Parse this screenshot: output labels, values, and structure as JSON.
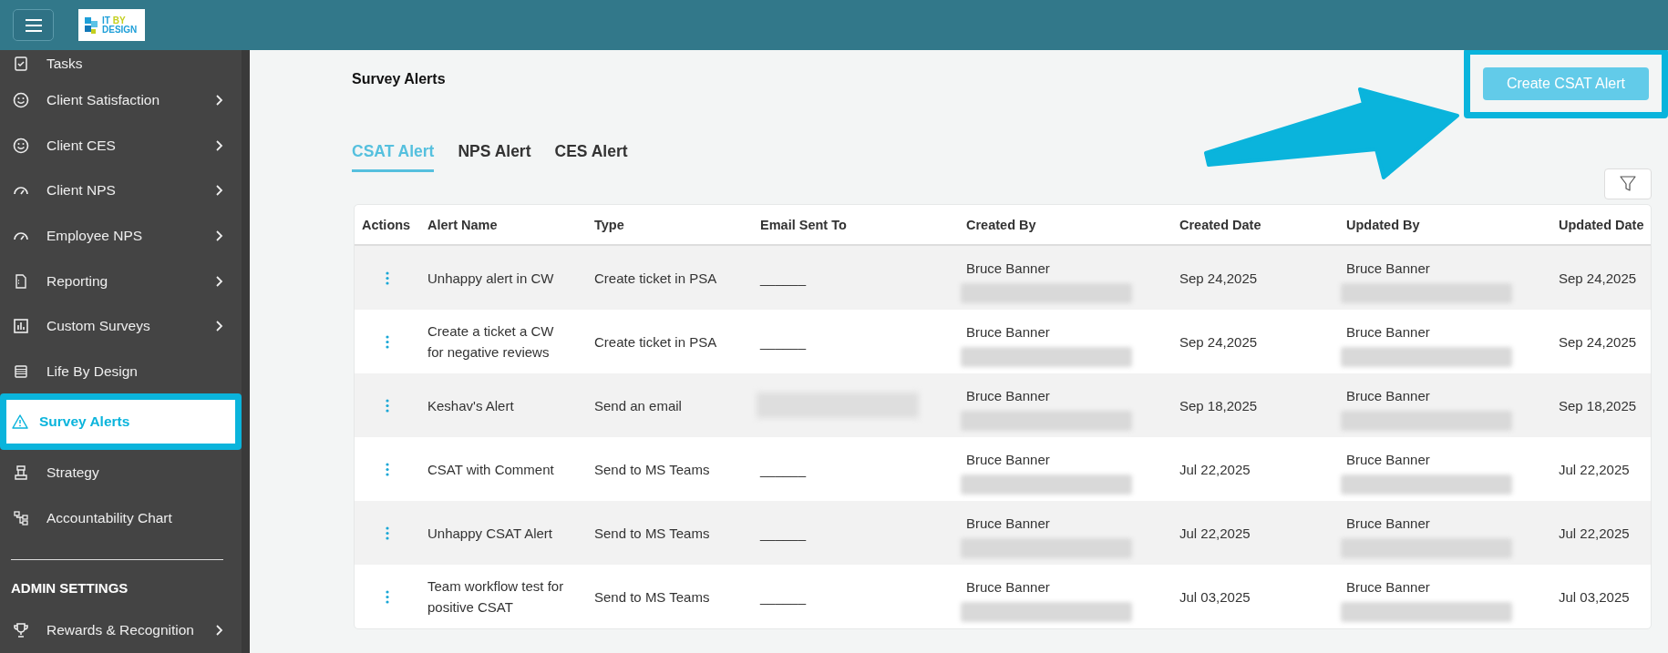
{
  "header": {
    "logo": {
      "word_1": "IT",
      "word_2": "BY",
      "word_3": "DESIGN"
    }
  },
  "sidebar": {
    "items": [
      {
        "label": "Tasks",
        "kind": "tasks",
        "has_submenu": false,
        "selected": false
      },
      {
        "label": "Client Satisfaction",
        "kind": "smiley",
        "has_submenu": true,
        "selected": false
      },
      {
        "label": "Client CES",
        "kind": "smiley",
        "has_submenu": true,
        "selected": false
      },
      {
        "label": "Client NPS",
        "kind": "gauge",
        "has_submenu": true,
        "selected": false
      },
      {
        "label": "Employee NPS",
        "kind": "gauge",
        "has_submenu": true,
        "selected": false
      },
      {
        "label": "Reporting",
        "kind": "document",
        "has_submenu": true,
        "selected": false
      },
      {
        "label": "Custom Surveys",
        "kind": "chart",
        "has_submenu": true,
        "selected": false
      },
      {
        "label": "Life By Design",
        "kind": "list",
        "has_submenu": false,
        "selected": false
      },
      {
        "label": "Survey Alerts",
        "kind": "warning",
        "has_submenu": false,
        "selected": true,
        "highlighted": true
      },
      {
        "label": "Strategy",
        "kind": "pedestal",
        "has_submenu": false,
        "selected": false
      },
      {
        "label": "Accountability Chart",
        "kind": "org",
        "has_submenu": false,
        "selected": false
      }
    ],
    "sections": [
      {
        "heading": "ADMIN SETTINGS",
        "items": [
          {
            "label": "Rewards & Recognition",
            "kind": "trophy",
            "has_submenu": true,
            "selected": false
          }
        ]
      }
    ]
  },
  "page": {
    "title": "Survey Alerts",
    "create_button": {
      "label": "Create CSAT Alert",
      "highlighted": true
    },
    "annotation_arrow": true,
    "tabs": [
      {
        "label": "CSAT Alert",
        "selected": true
      },
      {
        "label": "NPS Alert",
        "selected": false
      },
      {
        "label": "CES Alert",
        "selected": false
      }
    ],
    "table": {
      "columns": [
        "Actions",
        "Alert Name",
        "Type",
        "Email Sent To",
        "Created By",
        "Created Date",
        "Updated By",
        "Updated Date"
      ],
      "rows": [
        {
          "alert_name": "Unhappy alert in CW",
          "type": "Create ticket in PSA",
          "email_sent_to": "______",
          "created_by": "Bruce Banner",
          "created_date": "Sep 24,2025",
          "updated_by": "Bruce Banner",
          "updated_date": "Sep 24,2025"
        },
        {
          "alert_name": "Create a ticket a CW for negative reviews",
          "type": "Create ticket in PSA",
          "email_sent_to": "______",
          "created_by": "Bruce Banner",
          "created_date": "Sep 24,2025",
          "updated_by": "Bruce Banner",
          "updated_date": "Sep 24,2025"
        },
        {
          "alert_name": "Keshav's Alert",
          "type": "Send an email",
          "email_redacted": true,
          "created_by": "Bruce Banner",
          "created_date": "Sep 18,2025",
          "updated_by": "Bruce Banner",
          "updated_date": "Sep 18,2025"
        },
        {
          "alert_name": "CSAT with Comment",
          "type": "Send to MS Teams",
          "email_sent_to": "______",
          "created_by": "Bruce Banner",
          "created_date": "Jul 22,2025",
          "updated_by": "Bruce Banner",
          "updated_date": "Jul 22,2025"
        },
        {
          "alert_name": "Unhappy CSAT Alert",
          "type": "Send to MS Teams",
          "email_sent_to": "______",
          "created_by": "Bruce Banner",
          "created_date": "Jul 22,2025",
          "updated_by": "Bruce Banner",
          "updated_date": "Jul 22,2025"
        },
        {
          "alert_name": "Team workflow test for positive CSAT",
          "type": "Send to MS Teams",
          "email_sent_to": "______",
          "created_by": "Bruce Banner",
          "created_date": "Jul 03,2025",
          "updated_by": "Bruce Banner",
          "updated_date": "Jul 03,2025"
        }
      ]
    }
  }
}
